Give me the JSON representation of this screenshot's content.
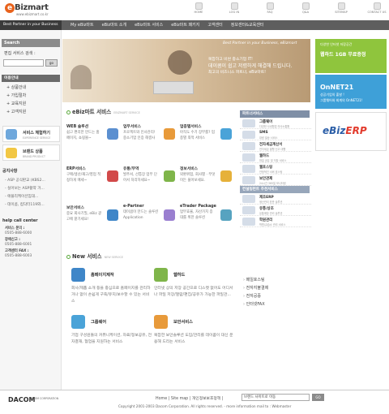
{
  "brand": {
    "logo_letter": "e",
    "logo_name": "Bizmart",
    "url": "www.ebizmart.co.kr",
    "tagline": "Best Partner in your Business"
  },
  "top_nav": [
    {
      "label": "HOME",
      "icon": "home-icon"
    },
    {
      "label": "LOG IN",
      "icon": "login-icon"
    },
    {
      "label": "FAQ",
      "icon": "faq-icon"
    },
    {
      "label": "Q&A",
      "icon": "qna-icon"
    },
    {
      "label": "SITEMAP",
      "icon": "sitemap-icon"
    },
    {
      "label": "CONTACT US",
      "icon": "contact-icon"
    }
  ],
  "gnb": [
    "My eBiz마트",
    "eBiz마트 소개",
    "eBiz마트 서비스",
    "eBiz마트 패키지",
    "고객센터",
    "정보센터&교육센터"
  ],
  "search": {
    "header": "Search",
    "label": "편집 서비스 검색 :",
    "placeholder": "",
    "go": "go"
  },
  "guide": {
    "header": "이용안내",
    "items": [
      "+ 상품안내",
      "+ 가입절차",
      "+ 교육지원",
      "+ 고객지원"
    ]
  },
  "banners": [
    {
      "title": "서비스 체험하기",
      "sub": "EXPERIENCE SERVICE",
      "icon": "experience-icon"
    },
    {
      "title": "브랜드 상품",
      "sub": "BRAND PRODUCT",
      "icon": "brand-icon"
    }
  ],
  "notice": {
    "header": "공지사항",
    "items": [
      "- ASP 공식판교 (KBS2...",
      "- 실어보는 ASP활약 거...",
      "- 애플리케이션임대...",
      "- 데이콤, 컴닥터119와..."
    ]
  },
  "help": {
    "header": "help call center",
    "lines": [
      {
        "label": "서비스 문의 :",
        "value": "0505-888-6000"
      },
      {
        "label": "장애신고 :",
        "value": "0505-888-6001"
      },
      {
        "label": "고객센터 FAX :",
        "value": "0505-888-6003"
      }
    ]
  },
  "hero": {
    "tag": "Best Partner in your Business, eBizmart",
    "lines": [
      "복잡하고 비싼 중소기업 IT!",
      "데이콤이 쉽고 저렴하게 해결해 드립니다.",
      "최고의 비즈니스 파트너, eBiz마트!"
    ]
  },
  "right_banners": [
    {
      "small": "다양한 인터넷 저장공간",
      "big": "웹하드 1GB 무료증정",
      "sub": "",
      "sub2": ""
    },
    {
      "small": "",
      "big": "OnNET21",
      "sub": "성공기업의 출발 !",
      "sub2": "그룹웨어와 회계의 OnNET21!"
    },
    {
      "small": "",
      "big": "eBiz",
      "accent": "ERP",
      "sub": "",
      "sub2": ""
    }
  ],
  "services": {
    "title": "eBiz마트 서비스",
    "title_en": "EBIZMART SERVICE",
    "items": [
      {
        "title": "WEB 솔루션",
        "desc": "쉽고 편리한 만드는 홈페이지, 쇼핑몰~",
        "color": "#5b8fd0"
      },
      {
        "title": "업무서비스",
        "desc": "프로젝트와 인사관리! 중소기업 인증 해결사",
        "color": "#e89a3a"
      },
      {
        "title": "업종별서비스",
        "desc": "아직도 수기 장부를? 업종별 최적 서비스",
        "color": "#4aa3d8"
      },
      {
        "title": "ERP서비스",
        "desc": "구매/생산/재고/영업 적정하게 매세~",
        "color": "#d24a4a"
      },
      {
        "title": "유통/무역",
        "desc": "발주서, 선통장 업무 단어서 처리하세요~",
        "color": "#7fb54a"
      },
      {
        "title": "정보서비스",
        "desc": "외환위험, 회사별 · 무엇이든 물어보세요.",
        "color": "#e6b13a"
      },
      {
        "title": "보안서비스",
        "desc": "중요 회사기밀, eBiz 광고에 맡기세요!",
        "color": "#3f86c8"
      },
      {
        "title": "e-Partner",
        "desc": "데이콤이 만드는 솔루션 Application",
        "color": "#9a7fd0"
      },
      {
        "title": "eTrader Package",
        "desc": "업무효율, 자산가치 증대를 위한 솔루션",
        "color": "#57a3c0"
      }
    ]
  },
  "new_services": {
    "title": "New 서비스",
    "title_en": "NEW SERVICE",
    "items": [
      {
        "title": "홈페이지제작",
        "desc": "회사/제품 소개 등을 중심으로 홈페이지를 관리하거나 없이 손쉽게 구축/유지/보수할 수 있는 서비스",
        "color": "#3f86c8"
      },
      {
        "title": "웹하드",
        "desc": "인터넷 상의 저장 공간으로 디스켓 없어도 어디서나 파일 저장/열람/편집/공유가 가능한 파일관...",
        "color": "#7fb54a"
      },
      {
        "title": "그룹웨어",
        "desc": "기업 구성원들의 커뮤니케이션, 자료/정보공유, 전자결재, 협업을 지원하는 서비스",
        "color": "#4aa3d8"
      },
      {
        "title": "보안서비스",
        "desc": "복잡한 보안솔루션 도입/관리를 데이콤이 대신 운용해 드리는 서비스",
        "color": "#e89a3a"
      }
    ]
  },
  "side_partner": {
    "header": "파트너서비스",
    "items": [
      {
        "title": "그룹웨어",
        "sub": "다양한 사내협업 의사소통툴"
      },
      {
        "title": "SMS",
        "sub": "대량 발송 서비스"
      },
      {
        "title": "전자세금계산서",
        "sub": "전자세금 발행 신고 대행"
      },
      {
        "title": "웹하드",
        "sub": "파일 공유 및 저장 서비스"
      },
      {
        "title": "웹호스팅",
        "sub": "안정적인 서버 호스팅"
      },
      {
        "title": "보안관제",
        "sub": "24시간 365일 모니터링"
      }
    ]
  },
  "side_recommend": {
    "header": "컨설팅펀트 추천서비스",
    "items": [
      {
        "title": "제조ERP",
        "sub": "생산관리 표준 솔루션"
      },
      {
        "title": "유통/상조",
        "sub": "유통매장 관리 솔루션"
      },
      {
        "title": "학원관리",
        "sub": "학원/교습소 관리 서비스"
      }
    ]
  },
  "side_links": [
    "메일호스팅",
    "전자지불결제",
    "전자공증",
    "인터넷FAX"
  ],
  "footer": {
    "company": "DACOM",
    "company_sub": "DACOM CORPORATION",
    "links": "Home | Site map | 개인정보보호정책 |",
    "select": "브랜드 사이트로 이동",
    "go": "GO",
    "copyright": "Copyright 2001-2003 Dacom Corporation. All rights reserved. - more information mail to : Webmaster"
  }
}
